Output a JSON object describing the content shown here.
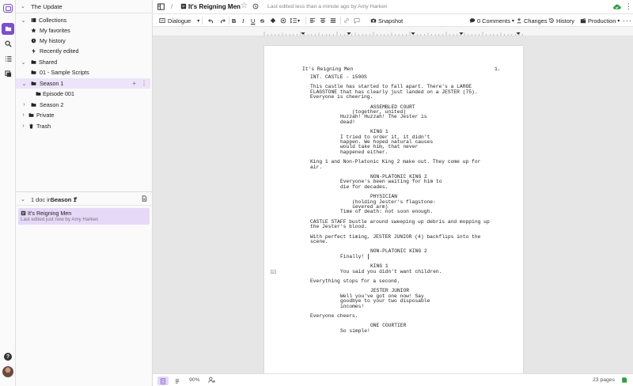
{
  "workspace": {
    "name": "The Update"
  },
  "sidebar": {
    "tree": [
      {
        "label": "Collections",
        "icon": "collection-icon",
        "expanded": true
      },
      {
        "label": "My favorites",
        "icon": "star-icon"
      },
      {
        "label": "My history",
        "icon": "clock-icon"
      },
      {
        "label": "Recently edited",
        "icon": "bolt-icon"
      },
      {
        "label": "Shared",
        "icon": "folder-icon",
        "expanded": true
      },
      {
        "label": "01 - Sample Scripts",
        "icon": "folder-icon"
      },
      {
        "label": "Season 1",
        "icon": "folder-icon",
        "expanded": true,
        "selected": true
      },
      {
        "label": "Episode 001",
        "icon": "folder-icon"
      },
      {
        "label": "Season 2",
        "icon": "folder-icon"
      },
      {
        "label": "Private",
        "icon": "folder-icon"
      },
      {
        "label": "Trash",
        "icon": "trash-icon"
      }
    ],
    "doc_list": {
      "count_label": "1 doc in",
      "folder": "Season 1",
      "items": [
        {
          "title": "It's Reigning Men",
          "subtitle": "Last edited just now by Amy Harken"
        }
      ]
    }
  },
  "header": {
    "breadcrumb_sep": "/",
    "doc_title": "It's Reigning Men",
    "last_edited": "Last edited less than a minute ago by Amy Harken"
  },
  "toolbar": {
    "element_type": "Dialogue",
    "snapshot": "Snapshot",
    "comments": "0 Comments",
    "changes": "Changes",
    "history": "History",
    "production": "Production"
  },
  "script": {
    "header_title": "It's Reigning Men",
    "page_number": "1.",
    "lines": [
      {
        "t": "INT. CASTLE - 1500S",
        "k": "action"
      },
      {
        "t": "This castle has started to fall apart. There's a LARGE",
        "k": "action"
      },
      {
        "t": "FLAGSTONE that has clearly just landed on a JESTER (75).",
        "k": "action"
      },
      {
        "t": "Everyone is cheering.",
        "k": "action"
      },
      {
        "t": "ASSEMBLED COURT",
        "k": "character"
      },
      {
        "t": "(together, united)",
        "k": "paren"
      },
      {
        "t": "Huzzah! Huzzah! The Jester is",
        "k": "dialogue"
      },
      {
        "t": "dead!",
        "k": "dialogue"
      },
      {
        "t": "KING 1",
        "k": "character"
      },
      {
        "t": "I tried to order it, it didn't",
        "k": "dialogue"
      },
      {
        "t": "happen. We hoped natural causes",
        "k": "dialogue"
      },
      {
        "t": "would take him, that never",
        "k": "dialogue"
      },
      {
        "t": "happened either.",
        "k": "dialogue"
      },
      {
        "t": "King 1 and Non-Platonic King 2 make out. They come up for",
        "k": "action"
      },
      {
        "t": "air.",
        "k": "action"
      },
      {
        "t": "NON-PLATONIC KING 2",
        "k": "character"
      },
      {
        "t": "Everyone's been waiting for him to",
        "k": "dialogue"
      },
      {
        "t": "die for decades.",
        "k": "dialogue"
      },
      {
        "t": "PHYSICIAN",
        "k": "character"
      },
      {
        "t": "(holding Jester's flagstone-",
        "k": "paren"
      },
      {
        "t": "severed arm)",
        "k": "paren"
      },
      {
        "t": "Time of death: not soon enough.",
        "k": "dialogue"
      },
      {
        "t": "CASTLE STAFF bustle around sweeping up debris and mopping up",
        "k": "action"
      },
      {
        "t": "the Jester's blood.",
        "k": "action"
      },
      {
        "t": "With perfect timing, JESTER JUNIOR (4) backflips into the",
        "k": "action"
      },
      {
        "t": "scene.",
        "k": "action"
      },
      {
        "t": "NON-PLATONIC KING 2",
        "k": "character"
      },
      {
        "t": "Finally!",
        "k": "dialogue"
      },
      {
        "t": "KING 1",
        "k": "character"
      },
      {
        "t": "You said you didn't want children.",
        "k": "dialogue"
      },
      {
        "t": "Everything stops for a second.",
        "k": "action"
      },
      {
        "t": "JESTER JUNIOR",
        "k": "character"
      },
      {
        "t": "Well you've got one now! Say",
        "k": "dialogue"
      },
      {
        "t": "goodbye to your two disposable",
        "k": "dialogue"
      },
      {
        "t": "incomes!",
        "k": "dialogue"
      },
      {
        "t": "Everyone cheers.",
        "k": "action"
      },
      {
        "t": "ONE COURTIER",
        "k": "character"
      },
      {
        "t": "So simple!",
        "k": "dialogue"
      }
    ]
  },
  "status": {
    "zoom": "90%",
    "pages": "23 pages"
  },
  "colors": {
    "accent": "#7b4fc9",
    "selected_bg": "#ede3fa",
    "sync_green": "#2f9e44"
  }
}
